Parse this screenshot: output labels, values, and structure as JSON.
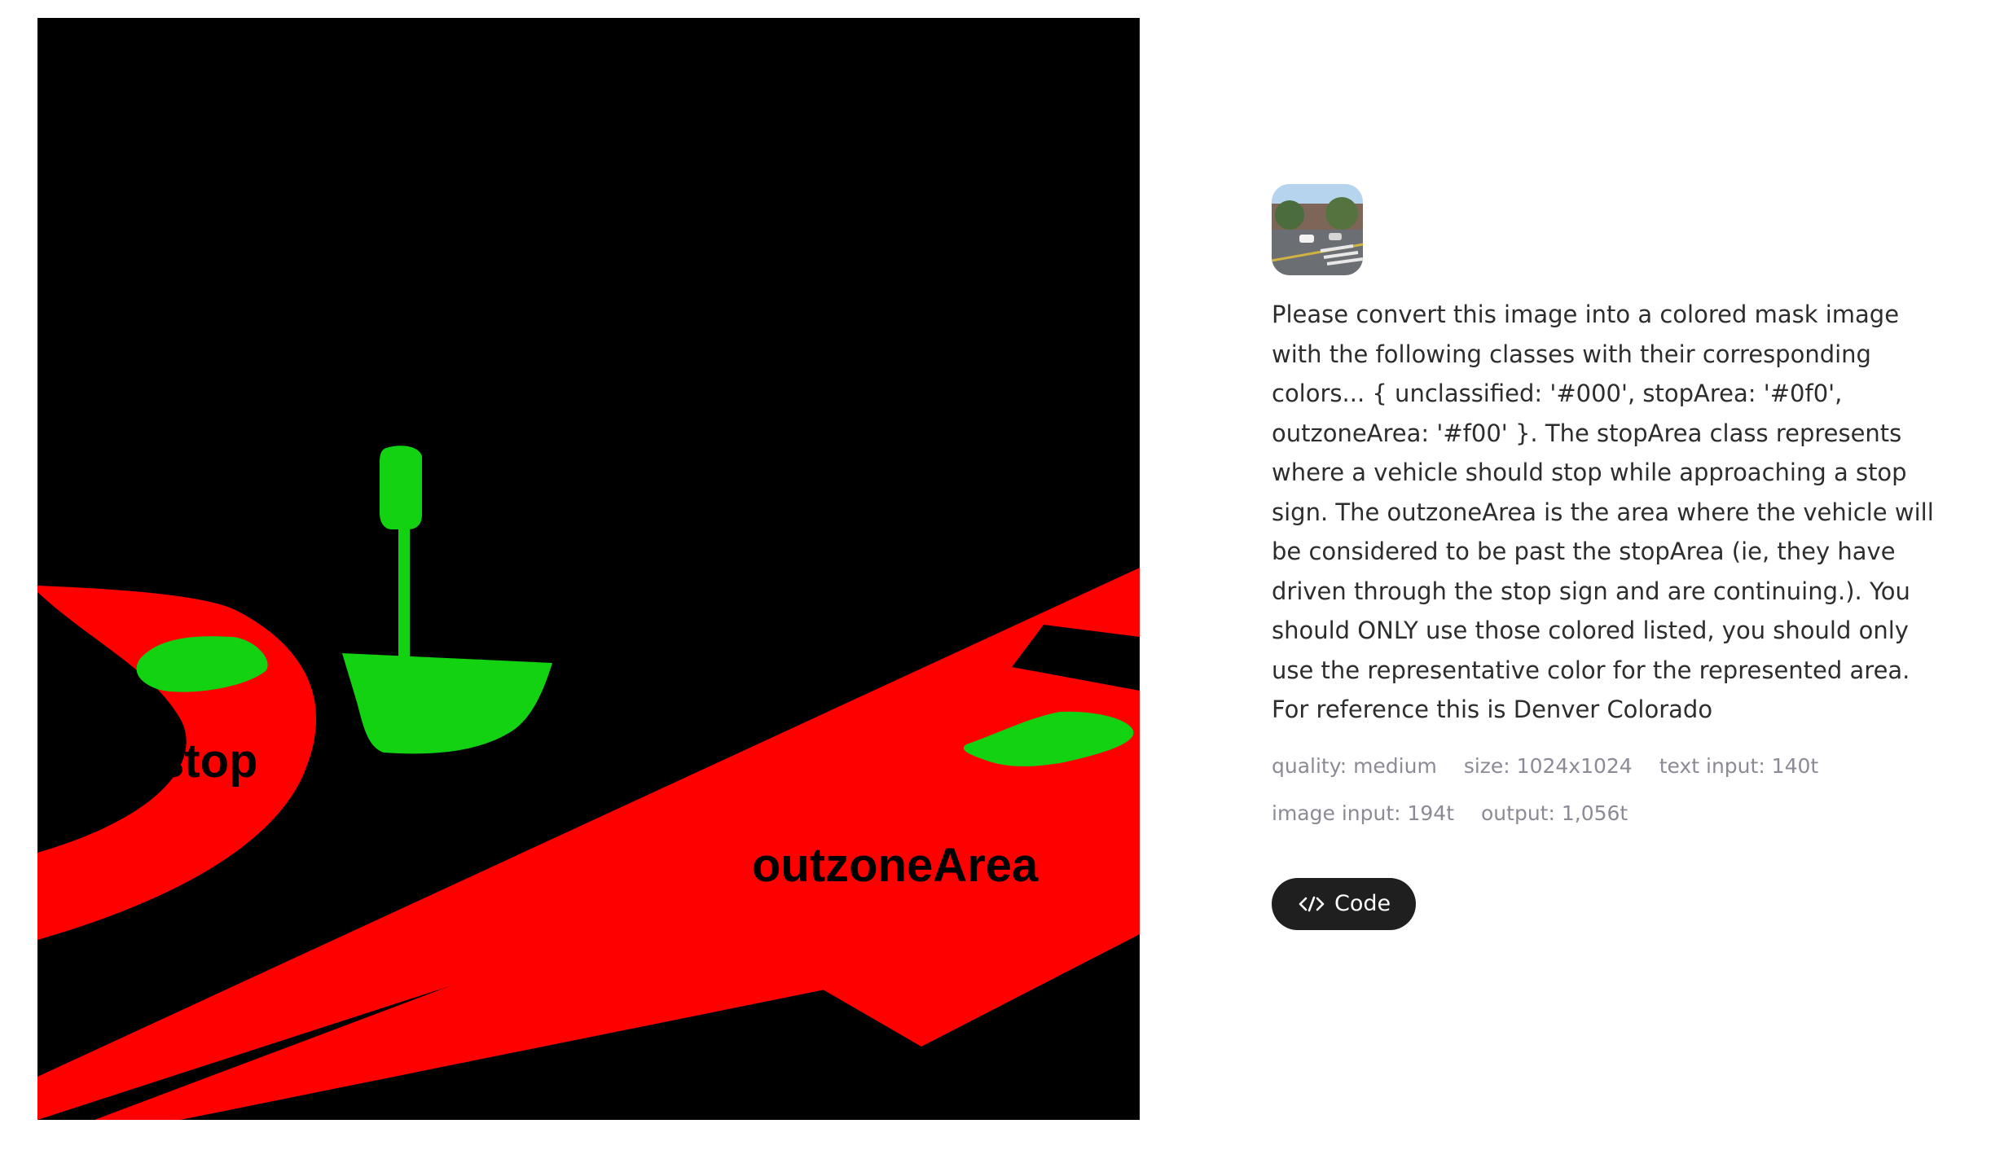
{
  "image_panel": {
    "labels": {
      "stop": "stop",
      "outzone": "outzoneArea"
    },
    "colors": {
      "unclassified": "#000000",
      "stopArea": "#12d212",
      "outzoneArea": "#ff0000"
    }
  },
  "thumbnail": {
    "icon": "street-photo-thumbnail"
  },
  "prompt_text": "Please convert this image into a colored mask image with the following classes with their corresponding colors... { unclassified: '#000', stopArea: '#0f0', outzoneArea: '#f00' }. The stopArea class represents where a vehicle should stop while approaching a stop sign. The outzoneArea is the area where the vehicle will be considered to be past the stopArea (ie, they have driven through the stop sign and are continuing.). You should ONLY use those colored listed, you should only use the representative color for the represented area. For reference this is Denver Colorado",
  "meta": {
    "quality": "quality: medium",
    "size": "size: 1024x1024",
    "text_input": "text input: 140t",
    "image_input": "image input: 194t",
    "output": "output: 1,056t"
  },
  "code_button": {
    "label": "Code",
    "icon": "code-icon"
  }
}
